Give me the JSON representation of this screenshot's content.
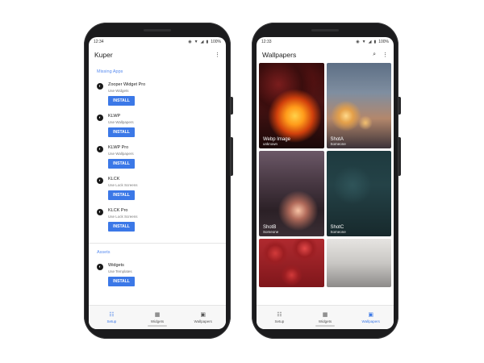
{
  "left_phone": {
    "status": {
      "time": "12:34",
      "battery": "100%"
    },
    "app_title": "Kuper",
    "sections": [
      {
        "title": "Missing Apps",
        "items": [
          {
            "title": "Zooper Widget Pro",
            "subtitle": "Use Widgets",
            "button": "INSTALL"
          },
          {
            "title": "KLWP",
            "subtitle": "Use Wallpapers",
            "button": "INSTALL"
          },
          {
            "title": "KLWP Pro",
            "subtitle": "Use Wallpapers",
            "button": "INSTALL"
          },
          {
            "title": "KLCK",
            "subtitle": "Use Lock Screens",
            "button": "INSTALL"
          },
          {
            "title": "KLCK Pro",
            "subtitle": "Use Lock Screens",
            "button": "INSTALL"
          }
        ]
      },
      {
        "title": "Assets",
        "items": [
          {
            "title": "Widgets",
            "subtitle": "Use Templates",
            "button": "INSTALL"
          }
        ]
      }
    ],
    "nav": [
      {
        "label": "Setup",
        "icon": "setup-icon",
        "active": true
      },
      {
        "label": "Widgets",
        "icon": "widgets-icon",
        "active": false
      },
      {
        "label": "Wallpapers",
        "icon": "wallpapers-icon",
        "active": false
      }
    ]
  },
  "right_phone": {
    "status": {
      "time": "12:33",
      "battery": "100%"
    },
    "app_title": "Wallpapers",
    "wallpapers": [
      {
        "title": "Webp Image",
        "author": "unknown"
      },
      {
        "title": "ShotA",
        "author": "Someone"
      },
      {
        "title": "ShotB",
        "author": "Someone"
      },
      {
        "title": "ShotC",
        "author": "Someone"
      },
      {
        "title": "",
        "author": ""
      },
      {
        "title": "",
        "author": ""
      }
    ],
    "nav": [
      {
        "label": "Setup",
        "icon": "setup-icon",
        "active": false
      },
      {
        "label": "Widgets",
        "icon": "widgets-icon",
        "active": false
      },
      {
        "label": "Wallpapers",
        "icon": "wallpapers-icon",
        "active": true
      }
    ]
  },
  "colors": {
    "accent": "#3b78e7",
    "section_title": "#5b8def",
    "phone_body": "#1b1b1d"
  }
}
